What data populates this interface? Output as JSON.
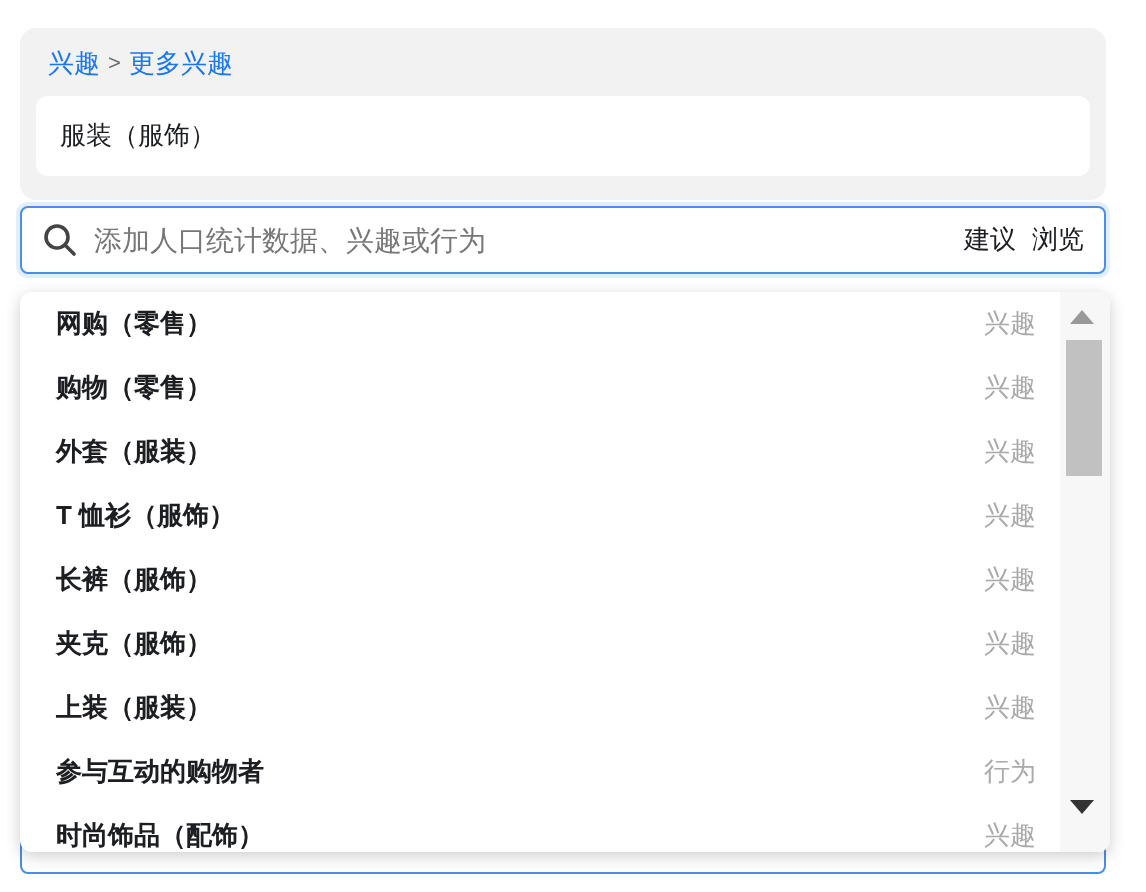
{
  "breadcrumb": [
    {
      "label": "兴趣"
    },
    {
      "label": "更多兴趣"
    }
  ],
  "breadcrumb_separator": ">",
  "selected_item": "服装（服饰）",
  "search": {
    "placeholder": "添加人口统计数据、兴趣或行为",
    "actions": [
      "建议",
      "浏览"
    ]
  },
  "suggestions": [
    {
      "name": "网购（零售）",
      "type": "兴趣"
    },
    {
      "name": "购物（零售）",
      "type": "兴趣"
    },
    {
      "name": "外套（服装）",
      "type": "兴趣"
    },
    {
      "name": "T 恤衫（服饰）",
      "type": "兴趣"
    },
    {
      "name": "长裤（服饰）",
      "type": "兴趣"
    },
    {
      "name": "夹克（服饰）",
      "type": "兴趣"
    },
    {
      "name": "上装（服装）",
      "type": "兴趣"
    },
    {
      "name": "参与互动的购物者",
      "type": "行为"
    },
    {
      "name": "时尚饰品（配饰）",
      "type": "兴趣"
    }
  ]
}
